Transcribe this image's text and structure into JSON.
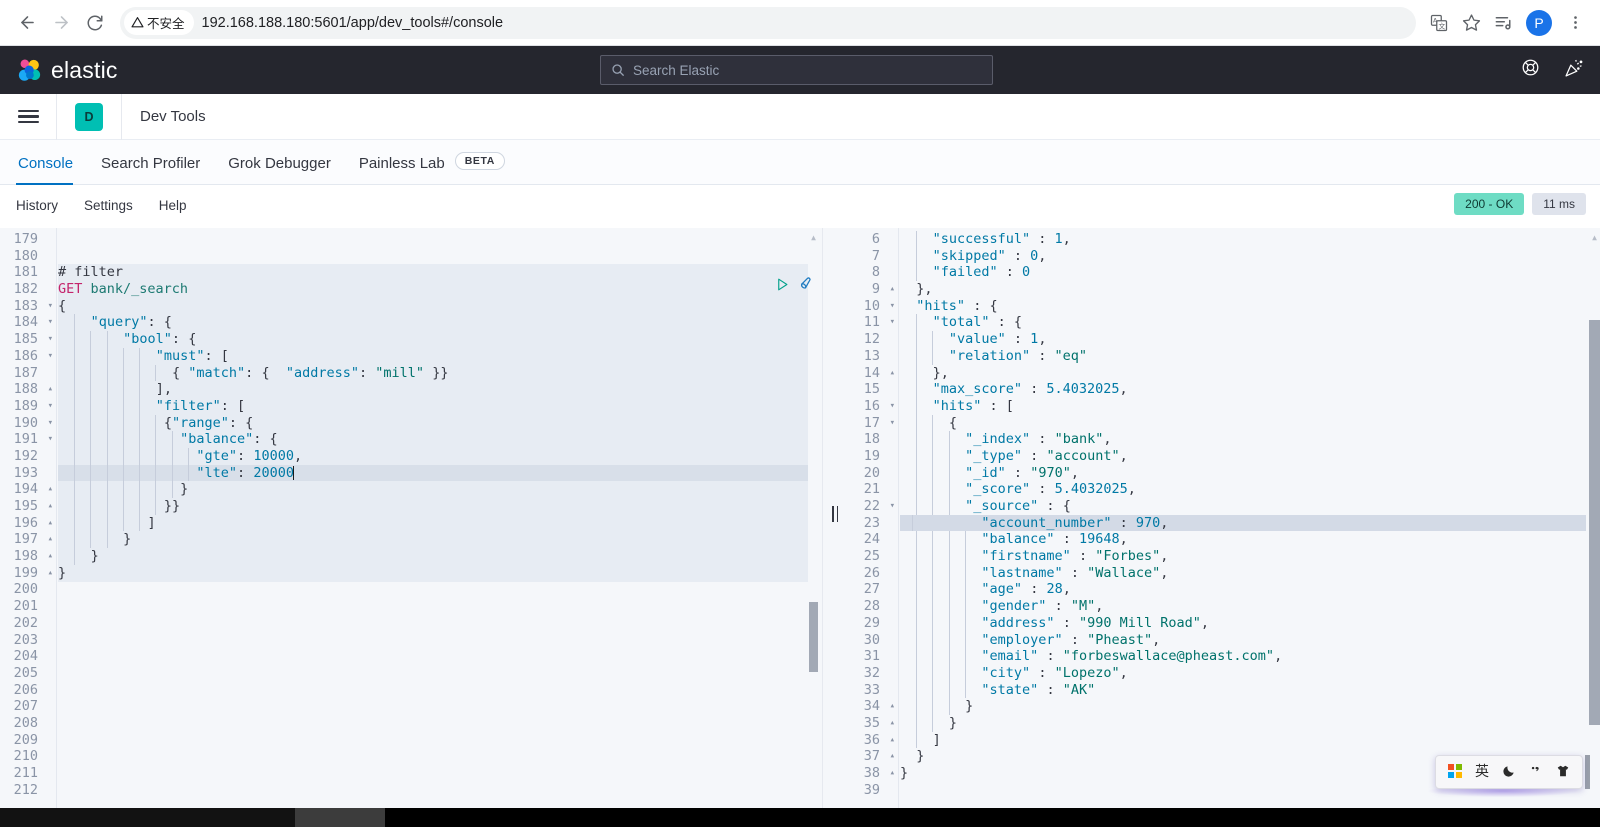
{
  "browser": {
    "back_icon": "arrow-left-icon",
    "forward_icon": "arrow-right-icon",
    "reload_icon": "reload-icon",
    "security_label": "不安全",
    "url": "192.168.188.180:5601/app/dev_tools#/console",
    "translate_icon": "translate-icon",
    "bookmark_icon": "star-icon",
    "reading_list_icon": "reading-list-icon",
    "profile_initial": "P",
    "menu_icon": "kebab-menu-icon"
  },
  "elastic_header": {
    "brand": "elastic",
    "search_placeholder": "Search Elastic",
    "search_icon": "search-icon",
    "help_icon": "help-lifebuoy-icon",
    "announcements_icon": "party-popper-icon"
  },
  "app_nav": {
    "menu_icon": "hamburger-menu-icon",
    "app_badge": "D",
    "app_title": "Dev Tools"
  },
  "tabs": [
    {
      "label": "Console",
      "active": true,
      "badge": null
    },
    {
      "label": "Search Profiler",
      "active": false,
      "badge": null
    },
    {
      "label": "Grok Debugger",
      "active": false,
      "badge": null
    },
    {
      "label": "Painless Lab",
      "active": false,
      "badge": "BETA"
    }
  ],
  "sub_toolbar": {
    "links": [
      "History",
      "Settings",
      "Help"
    ],
    "status_code": "200 - OK",
    "status_time": "11 ms",
    "status_color": "#6edcc4"
  },
  "console": {
    "play_icon": "play-request-icon",
    "wrench_icon": "wrench-icon",
    "splitter_icon": "pane-resize-handle",
    "editor": {
      "first_line": 179,
      "last_line": 212,
      "active_line": 193,
      "highlight_start": 181,
      "highlight_end": 199,
      "fold_lines": {
        "183": "down",
        "184": "down",
        "185": "down",
        "186": "down",
        "188": "up",
        "189": "down",
        "190": "down",
        "191": "down",
        "194": "up",
        "195": "up",
        "196": "up",
        "197": "up",
        "198": "up",
        "199": "up"
      },
      "lines": [
        {
          "n": 179,
          "text": ""
        },
        {
          "n": 180,
          "text": ""
        },
        {
          "n": 181,
          "text": "# filter"
        },
        {
          "n": 182,
          "text": "GET bank/_search"
        },
        {
          "n": 183,
          "text": "{"
        },
        {
          "n": 184,
          "text": "    \"query\": {"
        },
        {
          "n": 185,
          "text": "        \"bool\": {"
        },
        {
          "n": 186,
          "text": "            \"must\": ["
        },
        {
          "n": 187,
          "text": "              { \"match\": {  \"address\": \"mill\" }}"
        },
        {
          "n": 188,
          "text": "            ],"
        },
        {
          "n": 189,
          "text": "            \"filter\": ["
        },
        {
          "n": 190,
          "text": "             {\"range\": {"
        },
        {
          "n": 191,
          "text": "               \"balance\": {"
        },
        {
          "n": 192,
          "text": "                 \"gte\": 10000,"
        },
        {
          "n": 193,
          "text": "                 \"lte\": 20000"
        },
        {
          "n": 194,
          "text": "               }"
        },
        {
          "n": 195,
          "text": "             }}"
        },
        {
          "n": 196,
          "text": "           ]"
        },
        {
          "n": 197,
          "text": "        }"
        },
        {
          "n": 198,
          "text": "    }"
        },
        {
          "n": 199,
          "text": "}"
        },
        {
          "n": 200,
          "text": ""
        },
        {
          "n": 201,
          "text": ""
        },
        {
          "n": 202,
          "text": ""
        },
        {
          "n": 203,
          "text": ""
        },
        {
          "n": 204,
          "text": ""
        },
        {
          "n": 205,
          "text": ""
        },
        {
          "n": 206,
          "text": ""
        },
        {
          "n": 207,
          "text": ""
        },
        {
          "n": 208,
          "text": ""
        },
        {
          "n": 209,
          "text": ""
        },
        {
          "n": 210,
          "text": ""
        },
        {
          "n": 211,
          "text": ""
        },
        {
          "n": 212,
          "text": ""
        }
      ]
    },
    "response": {
      "first_line": 6,
      "last_line": 39,
      "active_line": 23,
      "fold_lines": {
        "9": "up",
        "10": "down",
        "11": "down",
        "14": "up",
        "16": "down",
        "17": "down",
        "22": "down",
        "34": "up",
        "35": "up",
        "36": "up",
        "37": "up",
        "38": "up"
      },
      "lines": [
        {
          "n": 6,
          "text": "    \"successful\" : 1,"
        },
        {
          "n": 7,
          "text": "    \"skipped\" : 0,"
        },
        {
          "n": 8,
          "text": "    \"failed\" : 0"
        },
        {
          "n": 9,
          "text": "  },"
        },
        {
          "n": 10,
          "text": "  \"hits\" : {"
        },
        {
          "n": 11,
          "text": "    \"total\" : {"
        },
        {
          "n": 12,
          "text": "      \"value\" : 1,"
        },
        {
          "n": 13,
          "text": "      \"relation\" : \"eq\""
        },
        {
          "n": 14,
          "text": "    },"
        },
        {
          "n": 15,
          "text": "    \"max_score\" : 5.4032025,"
        },
        {
          "n": 16,
          "text": "    \"hits\" : ["
        },
        {
          "n": 17,
          "text": "      {"
        },
        {
          "n": 18,
          "text": "        \"_index\" : \"bank\","
        },
        {
          "n": 19,
          "text": "        \"_type\" : \"account\","
        },
        {
          "n": 20,
          "text": "        \"_id\" : \"970\","
        },
        {
          "n": 21,
          "text": "        \"_score\" : 5.4032025,"
        },
        {
          "n": 22,
          "text": "        \"_source\" : {"
        },
        {
          "n": 23,
          "text": "          \"account_number\" : 970,"
        },
        {
          "n": 24,
          "text": "          \"balance\" : 19648,"
        },
        {
          "n": 25,
          "text": "          \"firstname\" : \"Forbes\","
        },
        {
          "n": 26,
          "text": "          \"lastname\" : \"Wallace\","
        },
        {
          "n": 27,
          "text": "          \"age\" : 28,"
        },
        {
          "n": 28,
          "text": "          \"gender\" : \"M\","
        },
        {
          "n": 29,
          "text": "          \"address\" : \"990 Mill Road\","
        },
        {
          "n": 30,
          "text": "          \"employer\" : \"Pheast\","
        },
        {
          "n": 31,
          "text": "          \"email\" : \"forbeswallace@pheast.com\","
        },
        {
          "n": 32,
          "text": "          \"city\" : \"Lopezo\","
        },
        {
          "n": 33,
          "text": "          \"state\" : \"AK\""
        },
        {
          "n": 34,
          "text": "        }"
        },
        {
          "n": 35,
          "text": "      }"
        },
        {
          "n": 36,
          "text": "    ]"
        },
        {
          "n": 37,
          "text": "  }"
        },
        {
          "n": 38,
          "text": "}"
        },
        {
          "n": 39,
          "text": ""
        }
      ]
    }
  },
  "ime": {
    "logo_icon": "windows-ime-logo-icon",
    "mode": "英",
    "moon_icon": "moon-icon",
    "punctuation_icon": "punctuation-icon",
    "skin_icon": "ime-skin-icon"
  },
  "taskbar": {
    "clock": ""
  }
}
